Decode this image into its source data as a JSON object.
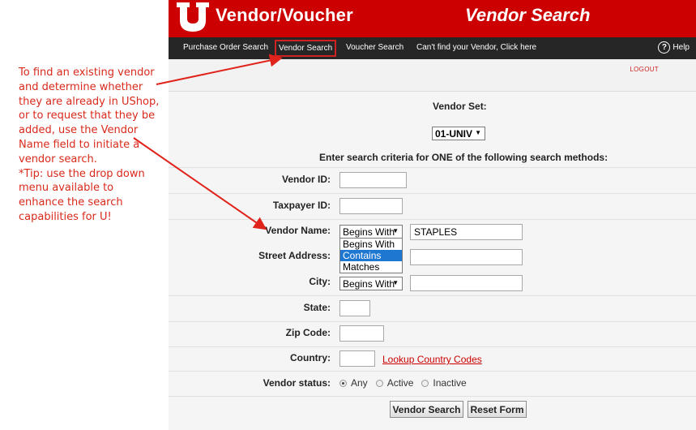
{
  "annotation": {
    "lines": [
      "To find an existing vendor",
      "and determine whether",
      "they are already in UShop,",
      "or to request that they be",
      "added, use the Vendor",
      "Name field to initiate a",
      "vendor search.",
      "*Tip: use the drop down",
      "menu available to",
      "enhance the search",
      "capabilities for U!"
    ]
  },
  "header": {
    "app_title": "Vendor/Voucher",
    "page_title": "Vendor Search"
  },
  "nav": {
    "items": [
      "Purchase Order Search",
      "Vendor Search",
      "Voucher Search",
      "Can't find your Vendor, Click here"
    ],
    "active_index": 1,
    "help_label": "Help"
  },
  "logout_label": "LOGOUT",
  "form": {
    "vendor_set_label": "Vendor Set:",
    "vendor_set_value": "01-UNIV",
    "criteria_heading": "Enter search criteria for ONE of the following search methods:",
    "vendor_id_label": "Vendor ID:",
    "taxpayer_id_label": "Taxpayer ID:",
    "vendor_name_label": "Vendor Name:",
    "vendor_name_operator": "Begins With",
    "vendor_name_value": "STAPLES",
    "operator_options": [
      "Begins With",
      "Contains",
      "Matches"
    ],
    "operator_highlighted": "Contains",
    "street_address_label": "Street Address:",
    "city_label": "City:",
    "city_operator": "Begins With",
    "state_label": "State:",
    "zip_label": "Zip Code:",
    "country_label": "Country:",
    "lookup_country_link": "Lookup Country Codes",
    "vendor_status_label": "Vendor status:",
    "status_options": [
      "Any",
      "Active",
      "Inactive"
    ],
    "status_selected": "Any",
    "search_button": "Vendor Search",
    "reset_button": "Reset Form"
  },
  "colors": {
    "brand_red": "#cc0000",
    "nav_dark": "#262626",
    "annotation_red": "#d92a1c",
    "highlight_blue": "#1e77d0"
  }
}
